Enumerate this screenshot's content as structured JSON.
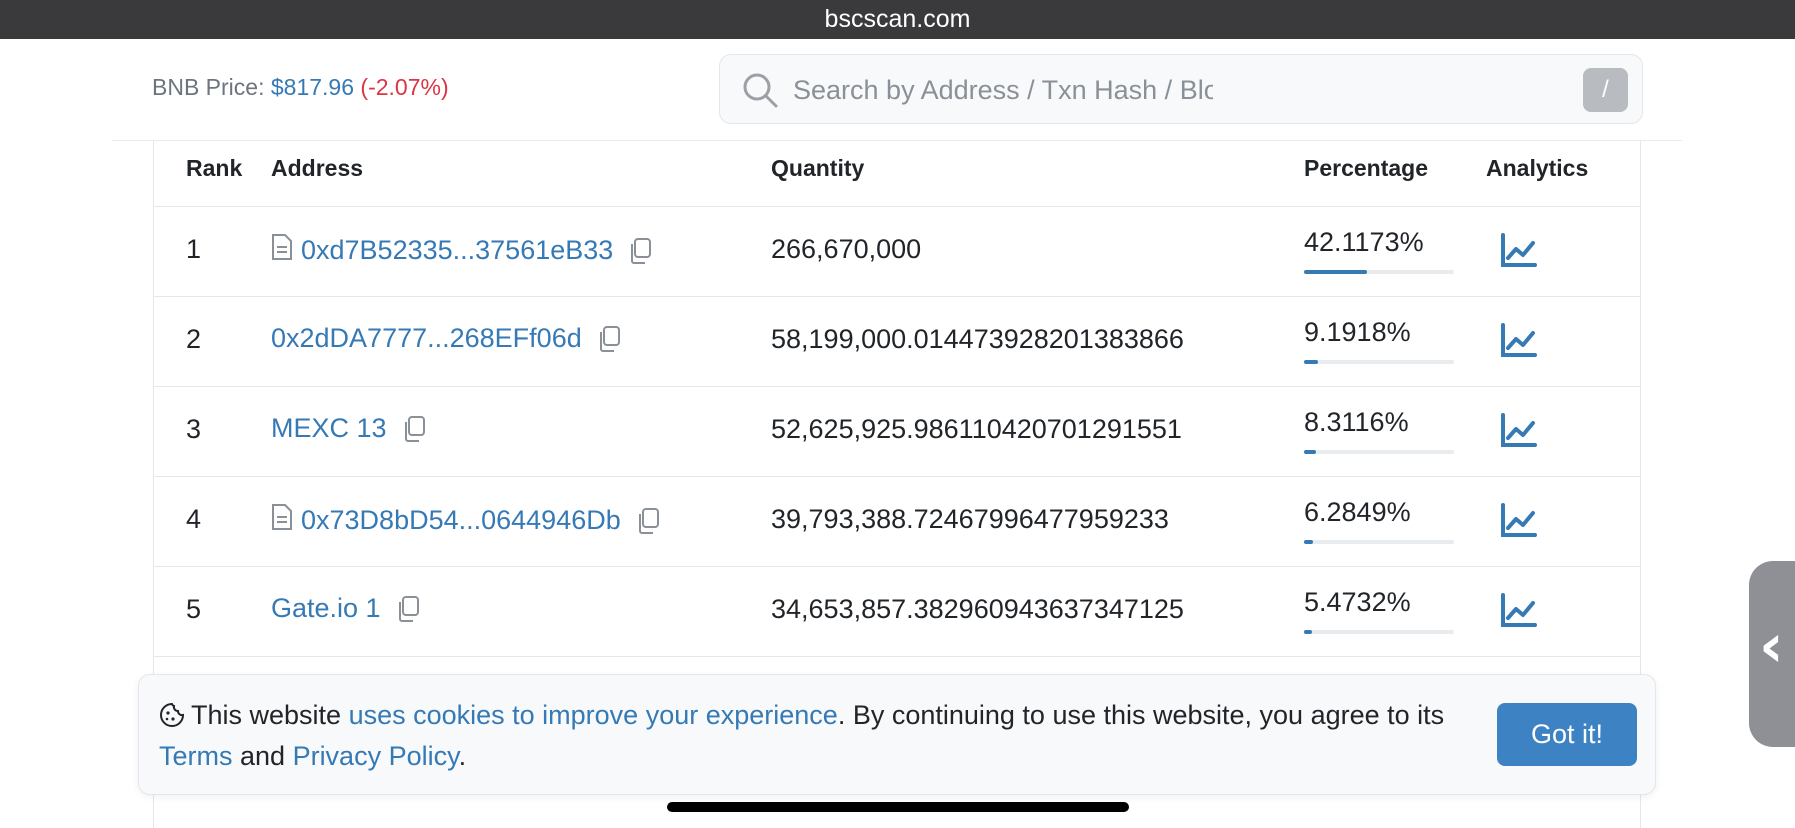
{
  "browser": {
    "url": "bscscan.com"
  },
  "header": {
    "bnb_label": "BNB Price: ",
    "bnb_price": "$817.96",
    "bnb_change": "(-2.07%)",
    "search_placeholder": "Search by Address / Txn Hash / Block / Token / Domai",
    "search_shortcut": "/"
  },
  "table": {
    "columns": {
      "rank": "Rank",
      "address": "Address",
      "quantity": "Quantity",
      "percentage": "Percentage",
      "analytics": "Analytics"
    },
    "rows": [
      {
        "rank": "1",
        "address": "0xd7B52335...37561eB33",
        "is_contract": true,
        "quantity": "266,670,000",
        "percentage": "42.1173%",
        "fill": 0.421
      },
      {
        "rank": "2",
        "address": "0x2dDA7777...268EFf06d",
        "is_contract": false,
        "quantity": "58,199,000.01447392820138386​6",
        "percentage": "9.1918%",
        "fill": 0.092
      },
      {
        "rank": "3",
        "address": "MEXC 13",
        "is_contract": false,
        "quantity": "52,625,925.98611042070129155​1",
        "percentage": "8.3116%",
        "fill": 0.083
      },
      {
        "rank": "4",
        "address": "0x73D8bD54...0644946Db",
        "is_contract": true,
        "quantity": "39,793,388.72467996477959233",
        "percentage": "6.2849%",
        "fill": 0.063
      },
      {
        "rank": "5",
        "address": "Gate.io 1",
        "is_contract": false,
        "quantity": "34,653,857.38296094363734712​5",
        "percentage": "5.4732%",
        "fill": 0.055
      }
    ]
  },
  "cookie_banner": {
    "text_1": "This website ",
    "link_1": "uses cookies to improve your experience",
    "text_2": ". By continuing to use this website, you agree to its ",
    "link_2": "Terms",
    "text_3": " and ",
    "link_3": "Privacy Policy",
    "text_4": ".",
    "button": "Got it!"
  },
  "side_tab": {
    "glyph": "‹"
  },
  "colors": {
    "link": "#3579b5",
    "negative": "#dc3545",
    "button": "#3d83c3"
  }
}
